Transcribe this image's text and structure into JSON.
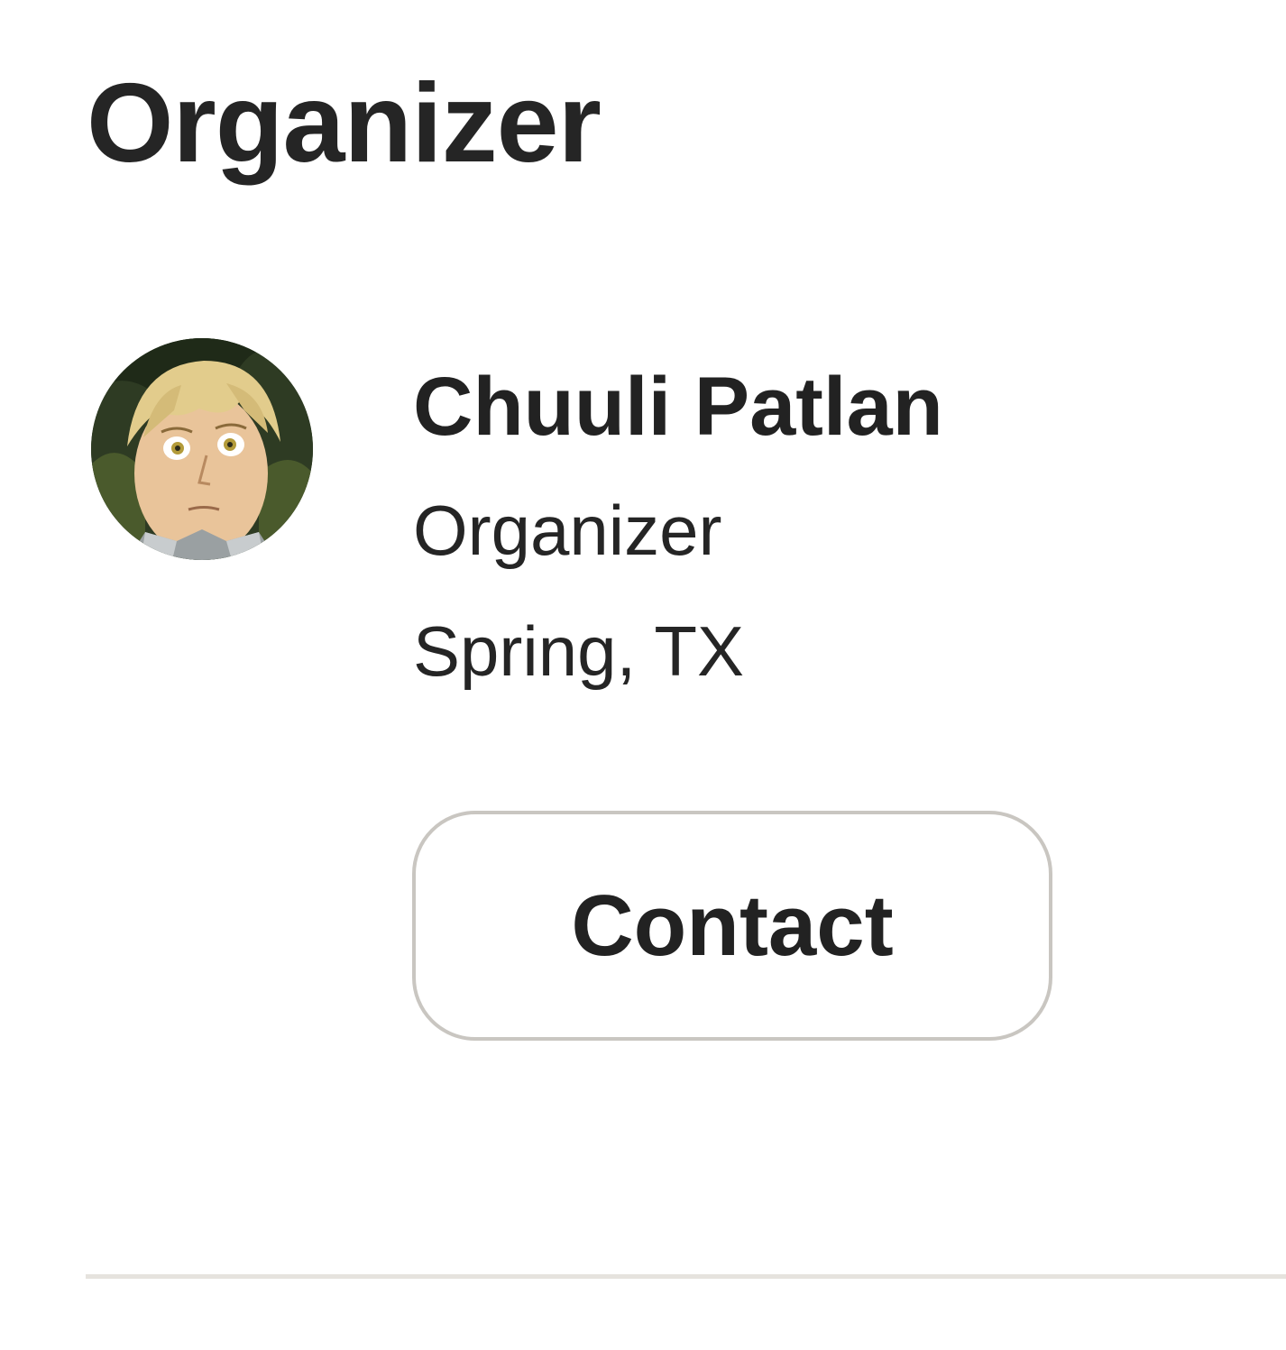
{
  "section": {
    "title": "Organizer"
  },
  "organizer": {
    "avatar_icon": "user-avatar-image",
    "name": "Chuuli Patlan",
    "role": "Organizer",
    "location": "Spring, TX"
  },
  "actions": {
    "contact_label": "Contact"
  },
  "colors": {
    "text": "#222222",
    "button_border": "#c9c6c1",
    "divider": "#e6e3de",
    "background": "#ffffff"
  }
}
